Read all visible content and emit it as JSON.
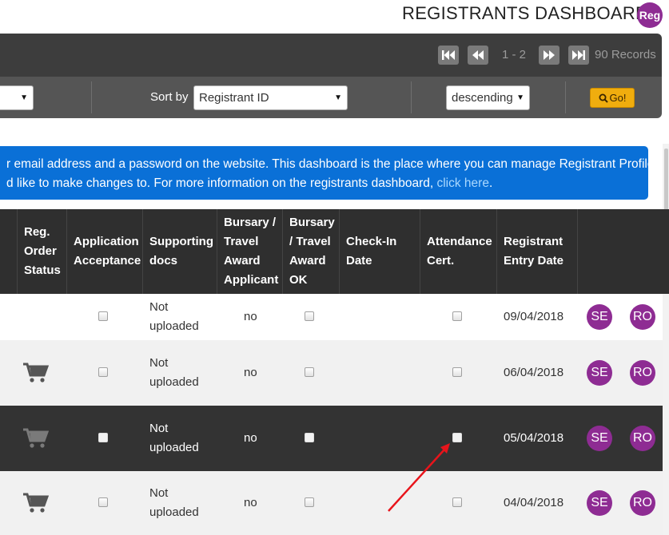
{
  "header": {
    "title": "REGISTRANTS DASHBOARD",
    "badge": "Reg"
  },
  "pager": {
    "range": "1 - 2",
    "records": "90 Records"
  },
  "filters": {
    "sort_label": "Sort by",
    "sort_field": "Registrant ID",
    "sort_order": "descending",
    "go_label": "Go!"
  },
  "info": {
    "line1": "r email address and a password on the website. This dashboard is the place where you can manage Registrant Profiles.",
    "line2": "d like to make changes to. For more information on the registrants dashboard, ",
    "link": "click here",
    "line2_end": "."
  },
  "table": {
    "headers": [
      [
        "Reg.",
        "Order",
        "Status"
      ],
      [
        "Application",
        "Acceptance"
      ],
      [
        "Supporting",
        "docs"
      ],
      [
        "Bursary /",
        "Travel",
        "Award",
        "Applicant"
      ],
      [
        "Bursary",
        "/ Travel",
        "Award",
        "OK"
      ],
      [
        "Check-In",
        "Date"
      ],
      [
        "Attendance",
        "Cert."
      ],
      [
        "Registrant",
        "Entry Date"
      ]
    ],
    "rows": [
      {
        "docs": [
          "Not",
          "uploaded"
        ],
        "bursary_applicant": "no",
        "entry_date": "09/04/2018",
        "badge1": "SE",
        "badge2": "RO",
        "cart": false
      },
      {
        "docs": [
          "Not",
          "uploaded"
        ],
        "bursary_applicant": "no",
        "entry_date": "06/04/2018",
        "badge1": "SE",
        "badge2": "RO",
        "cart": true
      },
      {
        "docs": [
          "Not",
          "uploaded"
        ],
        "bursary_applicant": "no",
        "entry_date": "05/04/2018",
        "badge1": "SE",
        "badge2": "RO",
        "cart": true
      },
      {
        "docs": [
          "Not",
          "uploaded"
        ],
        "bursary_applicant": "no",
        "entry_date": "04/04/2018",
        "badge1": "SE",
        "badge2": "RO",
        "cart": true
      }
    ]
  },
  "colors": {
    "badge": "#8e2c93",
    "info_banner": "#0a70d7",
    "go_button": "#f0ad0e",
    "annotation_arrow": "#e8141b"
  },
  "icons": [
    "first-page-icon",
    "prev-page-icon",
    "next-page-icon",
    "last-page-icon",
    "search-icon",
    "cart-icon"
  ]
}
